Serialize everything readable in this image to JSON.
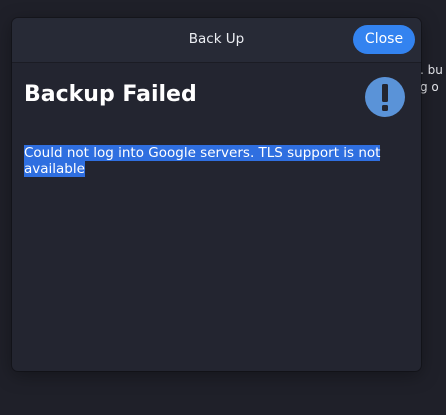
{
  "background": {
    "partial_text_lines": [
      ". bu",
      "g o"
    ]
  },
  "dialog": {
    "title": "Back Up",
    "close_label": "Close",
    "heading": "Backup Failed",
    "message": "Could not log into Google servers. TLS support is not available",
    "icon": "exclamation-circle-icon"
  },
  "colors": {
    "accent": "#3383f0",
    "selection": "#2f6fe0",
    "dialog_bg": "#232530",
    "header_bg": "#272a36",
    "icon_color": "#5a93d8"
  }
}
